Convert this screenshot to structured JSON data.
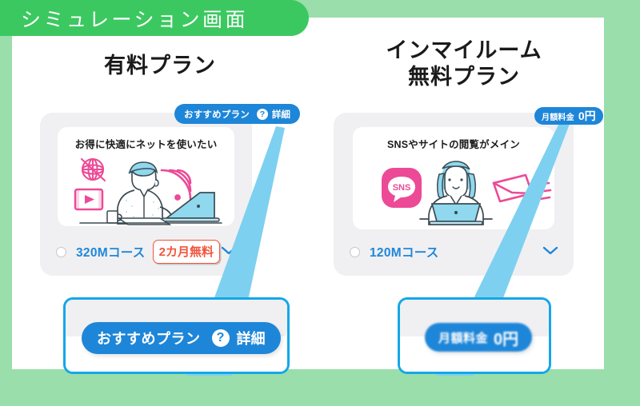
{
  "page": {
    "background_color": "#99deab",
    "sheet_color": "#ffffff"
  },
  "ribbon": {
    "label": "シミュレーション画面",
    "color": "#3cc860"
  },
  "columns": [
    {
      "title": "有料プラン",
      "card": {
        "caption": "お得に快適にネットを使いたい",
        "course": "320Mコース",
        "free_tag": "2カ月無料",
        "chevron": "chevron-down-icon",
        "radio_selected": false
      },
      "badge": {
        "label": "おすすめプラン",
        "help": "?",
        "detail": "詳細",
        "color": "#1e86d8"
      }
    },
    {
      "title": "インマイルーム\n無料プラン",
      "card": {
        "caption": "SNSやサイトの閲覧がメイン",
        "course": "120Mコース",
        "free_tag": "",
        "chevron": "chevron-down-icon",
        "radio_selected": false
      },
      "badge": {
        "label": "月額料金",
        "price": "0円",
        "color": "#1e86d8"
      }
    }
  ],
  "callouts": [
    {
      "label": "おすすめプラン",
      "help": "?",
      "detail": "詳細",
      "border_color": "#14a7e8"
    },
    {
      "label": "月額料金",
      "price": "0円",
      "border_color": "#14a7e8"
    }
  ],
  "beams": {
    "color": "#7ed0f0"
  },
  "illustrations": {
    "left": [
      "globe-icon",
      "film-icon",
      "man-with-laptop-illustration",
      "wifi-icon"
    ],
    "right": [
      "sns-chat-icon",
      "woman-with-laptop-illustration",
      "envelope-icon"
    ]
  },
  "accent_colors": {
    "blue": "#1e86d8",
    "light_blue": "#7ed0f0",
    "pink": "#ec4a96",
    "red": "#f2553d",
    "green": "#3cc860",
    "cyan": "#8fd8ee"
  }
}
